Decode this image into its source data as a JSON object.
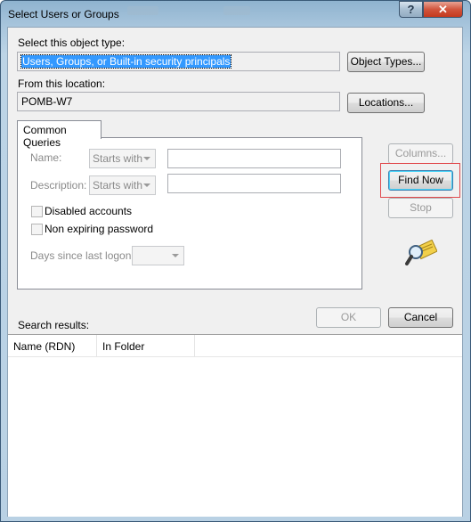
{
  "window": {
    "title": "Select Users or Groups",
    "help_label": "?",
    "close_label": "✕"
  },
  "object_type": {
    "label": "Select this object type:",
    "value": "Users, Groups, or Built-in security principals",
    "button": "Object Types..."
  },
  "location": {
    "label": "From this location:",
    "value": "POMB-W7",
    "button": "Locations..."
  },
  "queries": {
    "tab_label": "Common Queries",
    "name_label": "Name:",
    "name_mode": "Starts with",
    "description_label": "Description:",
    "description_mode": "Starts with",
    "disabled_accounts": "Disabled accounts",
    "non_expiring": "Non expiring password",
    "days_label": "Days since last logon:"
  },
  "side_buttons": {
    "columns": "Columns...",
    "find_now": "Find Now",
    "stop": "Stop"
  },
  "dialog_buttons": {
    "ok": "OK",
    "cancel": "Cancel"
  },
  "results": {
    "label": "Search results:",
    "columns": [
      "Name (RDN)",
      "In Folder"
    ]
  },
  "colors": {
    "title_gradient": "#a9c6dd",
    "close_red": "#c4391e",
    "selection_blue": "#3399ff",
    "highlight_red": "#e0494d"
  },
  "icons": {
    "search": "magnifier-icon"
  }
}
